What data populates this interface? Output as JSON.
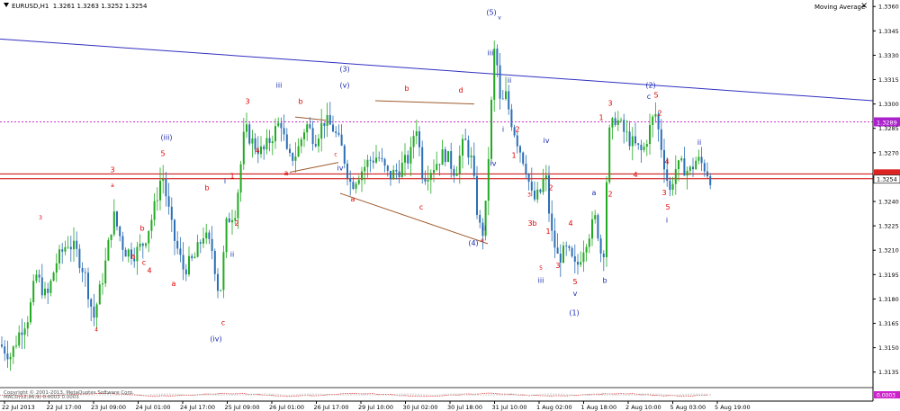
{
  "header": {
    "symbol": "EURUSD,H1",
    "ohlc": "1.3261 1.3263 1.3252 1.3254"
  },
  "indicator": {
    "label": "Moving Average",
    "close_icon": "close-icon"
  },
  "subwindow_label": "MACD(12,26,9) 0.0003 0.0003",
  "copyright": "Copyright © 2001-2013, MetaQuotes Software Corp.",
  "colors": {
    "bull": "#22aa22",
    "bear": "#2b6fb5",
    "trendline": "#3030c0",
    "channel": "#a05a2c",
    "level_line": "#cc33cc",
    "price_line": "#cc0000",
    "wave_red": "#e00000",
    "wave_blue": "#1a2ab0"
  },
  "chart_data": {
    "type": "candlestick",
    "symbol": "EURUSD",
    "timeframe": "H1",
    "y_ticks": [
      "1.3360",
      "1.3345",
      "1.3330",
      "1.3315",
      "1.3300",
      "1.3285",
      "1.3270",
      "1.3255",
      "1.3240",
      "1.3225",
      "1.3210",
      "1.3195",
      "1.3180",
      "1.3165",
      "1.3150",
      "1.3135"
    ],
    "x_ticks": [
      "22 Jul 2013",
      "22 Jul 17:00",
      "23 Jul 09:00",
      "24 Jul 01:00",
      "24 Jul 17:00",
      "25 Jul 09:00",
      "26 Jul 01:00",
      "26 Jul 17:00",
      "29 Jul 10:00",
      "30 Jul 02:00",
      "30 Jul 18:00",
      "31 Jul 10:00",
      "1 Aug 02:00",
      "1 Aug 18:00",
      "2 Aug 10:00",
      "5 Aug 03:00",
      "5 Aug 19:00"
    ],
    "ylim": [
      1.3126,
      1.3364
    ],
    "level_label": "1.3289",
    "level_value": 1.3289,
    "price_label": "1.3254",
    "price_value": 1.3254,
    "price_line_2": 1.3257,
    "macd_label": "0.0003",
    "price_path": [
      [
        0,
        1.3152
      ],
      [
        12,
        1.3145
      ],
      [
        22,
        1.316
      ],
      [
        32,
        1.317
      ],
      [
        40,
        1.3195
      ],
      [
        52,
        1.318
      ],
      [
        62,
        1.3202
      ],
      [
        75,
        1.3215
      ],
      [
        84,
        1.321
      ],
      [
        94,
        1.3196
      ],
      [
        104,
        1.3168
      ],
      [
        116,
        1.3198
      ],
      [
        126,
        1.3232
      ],
      [
        138,
        1.321
      ],
      [
        150,
        1.3208
      ],
      [
        160,
        1.3215
      ],
      [
        170,
        1.3232
      ],
      [
        180,
        1.3258
      ],
      [
        192,
        1.322
      ],
      [
        204,
        1.3198
      ],
      [
        216,
        1.3205
      ],
      [
        226,
        1.322
      ],
      [
        236,
        1.321
      ],
      [
        244,
        1.318
      ],
      [
        252,
        1.3228
      ],
      [
        262,
        1.3235
      ],
      [
        272,
        1.3285
      ],
      [
        282,
        1.3275
      ],
      [
        292,
        1.327
      ],
      [
        302,
        1.328
      ],
      [
        312,
        1.329
      ],
      [
        320,
        1.3265
      ],
      [
        330,
        1.327
      ],
      [
        340,
        1.3288
      ],
      [
        350,
        1.3278
      ],
      [
        360,
        1.329
      ],
      [
        370,
        1.3285
      ],
      [
        380,
        1.3272
      ],
      [
        390,
        1.325
      ],
      [
        400,
        1.3258
      ],
      [
        410,
        1.3265
      ],
      [
        420,
        1.3268
      ],
      [
        432,
        1.3255
      ],
      [
        444,
        1.326
      ],
      [
        456,
        1.3268
      ],
      [
        462,
        1.329
      ],
      [
        470,
        1.3255
      ],
      [
        482,
        1.3262
      ],
      [
        494,
        1.327
      ],
      [
        506,
        1.3258
      ],
      [
        516,
        1.3278
      ],
      [
        524,
        1.3265
      ],
      [
        532,
        1.3225
      ],
      [
        538,
        1.322
      ],
      [
        544,
        1.328
      ],
      [
        550,
        1.334
      ],
      [
        556,
        1.3298
      ],
      [
        562,
        1.3305
      ],
      [
        568,
        1.329
      ],
      [
        576,
        1.3275
      ],
      [
        584,
        1.3262
      ],
      [
        592,
        1.324
      ],
      [
        600,
        1.3245
      ],
      [
        606,
        1.3258
      ],
      [
        612,
        1.3222
      ],
      [
        620,
        1.3205
      ],
      [
        630,
        1.321
      ],
      [
        640,
        1.3198
      ],
      [
        650,
        1.3215
      ],
      [
        662,
        1.323
      ],
      [
        670,
        1.32
      ],
      [
        676,
        1.328
      ],
      [
        684,
        1.3292
      ],
      [
        694,
        1.3282
      ],
      [
        704,
        1.3275
      ],
      [
        714,
        1.327
      ],
      [
        722,
        1.3285
      ],
      [
        728,
        1.3295
      ],
      [
        736,
        1.327
      ],
      [
        744,
        1.3245
      ],
      [
        750,
        1.326
      ],
      [
        758,
        1.3262
      ],
      [
        766,
        1.3258
      ],
      [
        774,
        1.3266
      ],
      [
        782,
        1.3262
      ],
      [
        790,
        1.3254
      ]
    ],
    "trendlines": [
      {
        "name": "upper-trendline",
        "from": [
          0,
          1.334
        ],
        "to": [
          970,
          1.3302
        ]
      }
    ],
    "channel_lines": [
      {
        "from": [
          322,
          1.3258
        ],
        "to": [
          376,
          1.3264
        ]
      },
      {
        "from": [
          328,
          1.3292
        ],
        "to": [
          362,
          1.329
        ]
      },
      {
        "from": [
          417,
          1.3302
        ],
        "to": [
          527,
          1.33
        ]
      },
      {
        "from": [
          378,
          1.3245
        ],
        "to": [
          542,
          1.3214
        ]
      }
    ],
    "annotations": [
      {
        "t": "3",
        "x": 45,
        "y": 1.3229,
        "c": "red",
        "s": "s"
      },
      {
        "t": "3",
        "x": 125,
        "y": 1.3258,
        "c": "red"
      },
      {
        "t": "a",
        "x": 125,
        "y": 1.3249,
        "c": "red",
        "s": "s"
      },
      {
        "t": "5",
        "x": 181,
        "y": 1.3268,
        "c": "red"
      },
      {
        "t": "(iii)",
        "x": 185,
        "y": 1.3278,
        "c": "blue"
      },
      {
        "t": "b",
        "x": 158,
        "y": 1.3222,
        "c": "red"
      },
      {
        "t": "a",
        "x": 148,
        "y": 1.3205,
        "c": "red"
      },
      {
        "t": "c",
        "x": 160,
        "y": 1.3201,
        "c": "red"
      },
      {
        "t": "4",
        "x": 166,
        "y": 1.3196,
        "c": "red"
      },
      {
        "t": "a",
        "x": 193,
        "y": 1.3188,
        "c": "red"
      },
      {
        "t": "4",
        "x": 107,
        "y": 1.316,
        "c": "red",
        "s": "s"
      },
      {
        "t": "b",
        "x": 230,
        "y": 1.3247,
        "c": "red"
      },
      {
        "t": "c",
        "x": 248,
        "y": 1.3164,
        "c": "red"
      },
      {
        "t": "(iv)",
        "x": 240,
        "y": 1.3154,
        "c": "blue"
      },
      {
        "t": "ii",
        "x": 258,
        "y": 1.3206,
        "c": "blue"
      },
      {
        "t": "i",
        "x": 250,
        "y": 1.3251,
        "c": "blue"
      },
      {
        "t": "1",
        "x": 258,
        "y": 1.3254,
        "c": "red"
      },
      {
        "t": "2",
        "x": 263,
        "y": 1.3225,
        "c": "red"
      },
      {
        "t": "3",
        "x": 275,
        "y": 1.33,
        "c": "red"
      },
      {
        "t": "4",
        "x": 286,
        "y": 1.327,
        "c": "red"
      },
      {
        "t": "iii",
        "x": 310,
        "y": 1.331,
        "c": "blue"
      },
      {
        "t": "(3)",
        "x": 383,
        "y": 1.332,
        "c": "blue"
      },
      {
        "t": "(v)",
        "x": 383,
        "y": 1.331,
        "c": "blue"
      },
      {
        "t": "b",
        "x": 334,
        "y": 1.33,
        "c": "red"
      },
      {
        "t": "a",
        "x": 318,
        "y": 1.3256,
        "c": "red"
      },
      {
        "t": "c",
        "x": 373,
        "y": 1.3268,
        "c": "red",
        "s": "s"
      },
      {
        "t": "iv",
        "x": 378,
        "y": 1.3259,
        "c": "blue"
      },
      {
        "t": "a",
        "x": 392,
        "y": 1.324,
        "c": "red"
      },
      {
        "t": "b",
        "x": 452,
        "y": 1.3308,
        "c": "red"
      },
      {
        "t": "c",
        "x": 468,
        "y": 1.3235,
        "c": "red"
      },
      {
        "t": "d",
        "x": 512,
        "y": 1.3307,
        "c": "red"
      },
      {
        "t": "(4)",
        "x": 526,
        "y": 1.3213,
        "c": "blue"
      },
      {
        "t": "e",
        "x": 536,
        "y": 1.3215,
        "c": "red",
        "s": "s"
      },
      {
        "t": "ii",
        "x": 538,
        "y": 1.3222,
        "c": "blue"
      },
      {
        "t": "(5)",
        "x": 546,
        "y": 1.3355,
        "c": "blue"
      },
      {
        "t": "v",
        "x": 555,
        "y": 1.3352,
        "c": "blue",
        "s": "s"
      },
      {
        "t": "iii",
        "x": 545,
        "y": 1.333,
        "c": "blue"
      },
      {
        "t": "ii",
        "x": 566,
        "y": 1.3313,
        "c": "blue"
      },
      {
        "t": "i",
        "x": 559,
        "y": 1.3283,
        "c": "blue"
      },
      {
        "t": "iv",
        "x": 548,
        "y": 1.3262,
        "c": "blue"
      },
      {
        "t": "2",
        "x": 575,
        "y": 1.3283,
        "c": "red"
      },
      {
        "t": "1",
        "x": 571,
        "y": 1.3267,
        "c": "red"
      },
      {
        "t": "3",
        "x": 588,
        "y": 1.3243,
        "c": "red",
        "s": "s"
      },
      {
        "t": "3",
        "x": 589,
        "y": 1.3225,
        "c": "red"
      },
      {
        "t": "b",
        "x": 594,
        "y": 1.3225,
        "c": "red"
      },
      {
        "t": "iv",
        "x": 607,
        "y": 1.3276,
        "c": "blue"
      },
      {
        "t": "2",
        "x": 612,
        "y": 1.3247,
        "c": "red"
      },
      {
        "t": "1",
        "x": 609,
        "y": 1.322,
        "c": "red"
      },
      {
        "t": "4",
        "x": 634,
        "y": 1.3225,
        "c": "red"
      },
      {
        "t": "3",
        "x": 620,
        "y": 1.3199,
        "c": "red"
      },
      {
        "t": "5",
        "x": 601,
        "y": 1.3198,
        "c": "red",
        "s": "s"
      },
      {
        "t": "iii",
        "x": 601,
        "y": 1.319,
        "c": "blue"
      },
      {
        "t": "5",
        "x": 639,
        "y": 1.3189,
        "c": "red"
      },
      {
        "t": "v",
        "x": 639,
        "y": 1.3182,
        "c": "blue"
      },
      {
        "t": "(1)",
        "x": 638,
        "y": 1.317,
        "c": "blue"
      },
      {
        "t": "a",
        "x": 660,
        "y": 1.3244,
        "c": "blue"
      },
      {
        "t": "b",
        "x": 672,
        "y": 1.319,
        "c": "blue"
      },
      {
        "t": "2",
        "x": 678,
        "y": 1.3243,
        "c": "red"
      },
      {
        "t": "1",
        "x": 668,
        "y": 1.329,
        "c": "red"
      },
      {
        "t": "3",
        "x": 678,
        "y": 1.3299,
        "c": "red"
      },
      {
        "t": "(2)",
        "x": 723,
        "y": 1.331,
        "c": "blue"
      },
      {
        "t": "c",
        "x": 721,
        "y": 1.3303,
        "c": "blue"
      },
      {
        "t": "5",
        "x": 729,
        "y": 1.3304,
        "c": "red"
      },
      {
        "t": "2",
        "x": 733,
        "y": 1.3293,
        "c": "red"
      },
      {
        "t": "4",
        "x": 706,
        "y": 1.3255,
        "c": "red"
      },
      {
        "t": "4",
        "x": 741,
        "y": 1.3263,
        "c": "red"
      },
      {
        "t": "3",
        "x": 738,
        "y": 1.3244,
        "c": "red"
      },
      {
        "t": "5",
        "x": 742,
        "y": 1.3235,
        "c": "red"
      },
      {
        "t": "i",
        "x": 741,
        "y": 1.3227,
        "c": "blue"
      },
      {
        "t": "ii",
        "x": 777,
        "y": 1.3275,
        "c": "blue"
      }
    ]
  }
}
